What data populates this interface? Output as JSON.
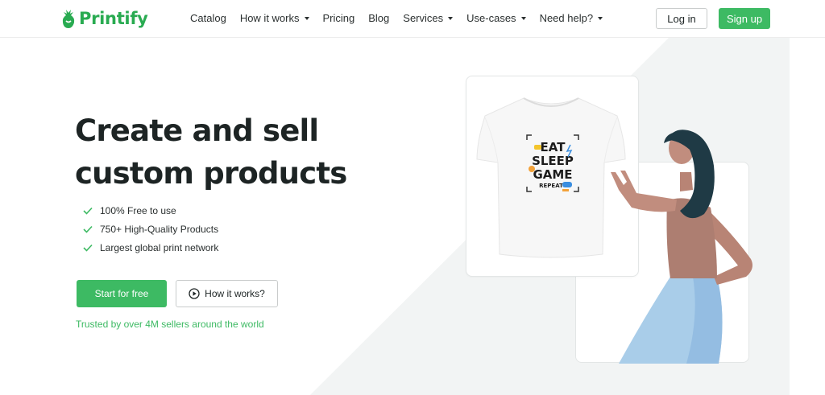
{
  "header": {
    "logo_text": "Printify",
    "nav": [
      {
        "label": "Catalog",
        "dropdown": false
      },
      {
        "label": "How it works",
        "dropdown": true
      },
      {
        "label": "Pricing",
        "dropdown": false
      },
      {
        "label": "Blog",
        "dropdown": false
      },
      {
        "label": "Services",
        "dropdown": true
      },
      {
        "label": "Use-cases",
        "dropdown": true
      },
      {
        "label": "Need help?",
        "dropdown": true
      }
    ],
    "login_label": "Log in",
    "signup_label": "Sign up"
  },
  "hero": {
    "title_line1": "Create and sell",
    "title_line2": "custom products",
    "features": [
      "100% Free to use",
      "750+ High-Quality Products",
      "Largest global print network"
    ],
    "start_label": "Start for free",
    "how_label": "How it works?",
    "trusted": "Trusted by over 4M sellers around the world"
  },
  "design": {
    "lines": [
      "EAT",
      "SLEEP",
      "GAME",
      "REPEAT"
    ]
  },
  "colors": {
    "brand_green": "#3dba63",
    "text_dark": "#1d2424",
    "skin": "#c18d7e",
    "hair": "#1f3a45",
    "skirt": "#a9cde9"
  },
  "icons": {
    "logo": "printify-logo-icon",
    "check": "check-icon",
    "play": "play-circle-icon",
    "caret": "chevron-down-icon"
  }
}
